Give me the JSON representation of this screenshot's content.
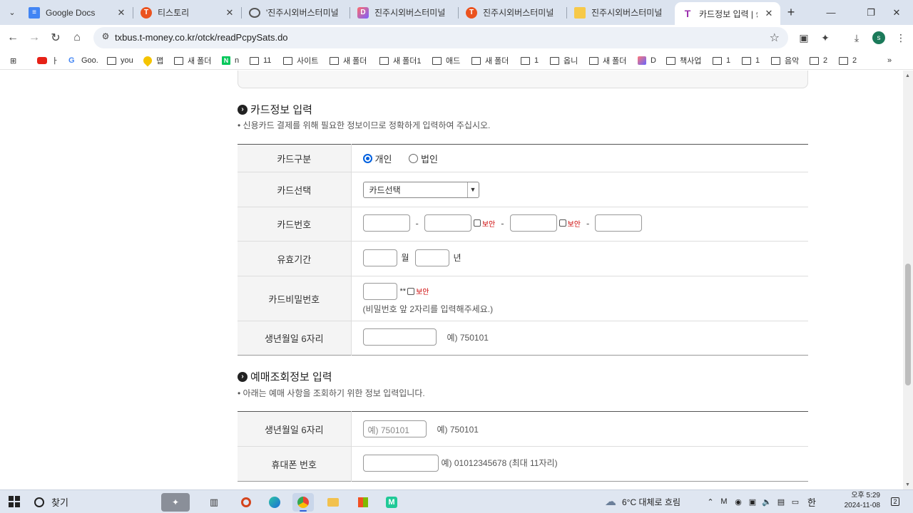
{
  "browser": {
    "tabs": [
      {
        "title": "Google Docs",
        "favicon": "docs-icon",
        "color": "#4285f4"
      },
      {
        "title": "티스토리",
        "favicon": "tistory-icon",
        "color": "#eb531f"
      },
      {
        "title": "'진주시외버스터미널",
        "favicon": "globe-icon",
        "color": "#555555"
      },
      {
        "title": "진주시외버스터미널",
        "favicon": "d-icon",
        "color": "#7b61ff"
      },
      {
        "title": "진주시외버스터미널",
        "favicon": "tistory-icon",
        "color": "#eb531f"
      },
      {
        "title": "진주시외버스터미널",
        "favicon": "note-icon",
        "color": "#f7c948"
      },
      {
        "title": "카드정보 입력 | 승차",
        "favicon": "tmoney-icon",
        "color": "#9b2fae"
      }
    ],
    "url": "txbus.t-money.co.kr/otck/readPcpySats.do",
    "profile_initial": "s",
    "bookmarks": [
      "ㅏ",
      "Goo.",
      "you",
      "맵",
      "새 폴더",
      "n",
      "11",
      "사이트",
      "새 폴더",
      "새 폴더1",
      "애드",
      "새 폴더",
      "1",
      "옵니",
      "새 폴더",
      "D",
      "책사업",
      "1",
      "1",
      "음악",
      "2",
      "2"
    ]
  },
  "card_section": {
    "title": "카드정보 입력",
    "desc": "• 신용카드 결제를 위해 필요한 정보이므로 정확하게 입력하여 주십시오.",
    "rows": {
      "card_type": {
        "label": "카드구분",
        "option_personal": "개인",
        "option_corporate": "법인",
        "selected": "개인"
      },
      "card_select": {
        "label": "카드선택",
        "value": "카드선택"
      },
      "card_number": {
        "label": "카드번호",
        "secure": "보안"
      },
      "expiry": {
        "label": "유효기간",
        "month": "월",
        "year": "년"
      },
      "password": {
        "label": "카드비밀번호",
        "mask": "**",
        "secure": "보안",
        "hint": "(비밀번호 앞 2자리를 입력해주세요.)"
      },
      "birth": {
        "label": "생년월일 6자리",
        "example": "예) 750101"
      }
    }
  },
  "lookup_section": {
    "title": "예매조회정보 입력",
    "desc": "• 아래는 예매 사항을 조회하기 위한 정보 입력입니다.",
    "rows": {
      "birth": {
        "label": "생년월일 6자리",
        "placeholder": "예) 750101",
        "example": "예) 750101"
      },
      "phone": {
        "label": "휴대폰 번호",
        "example": "예) 01012345678 (최대 11자리)"
      }
    }
  },
  "taskbar": {
    "search_label": "찾기",
    "weather": "6°C  대체로 흐림",
    "ime": "한",
    "time_ampm": "오후 5:29",
    "date": "2024-11-08",
    "notification_count": "2"
  }
}
